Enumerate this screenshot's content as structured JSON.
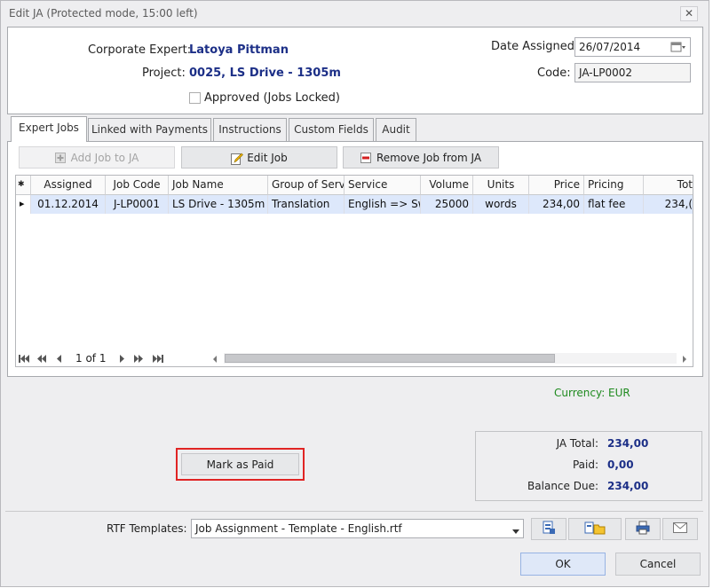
{
  "window": {
    "title": "Edit JA (Protected mode, 15:00 left)",
    "close_label": "✕"
  },
  "header": {
    "expert_label": "Corporate Expert:",
    "expert_value": "Latoya Pittman",
    "project_label": "Project:",
    "project_value": "0025, LS Drive - 1305m",
    "approved_label": "Approved (Jobs Locked)",
    "approved_checked": false,
    "date_label": "Date Assigned:",
    "date_value": "26/07/2014",
    "code_label": "Code:",
    "code_value": "JA-LP0002"
  },
  "tabs": [
    "Expert Jobs",
    "Linked with Payments",
    "Instructions",
    "Custom Fields",
    "Audit"
  ],
  "active_tab": "Expert Jobs",
  "toolbar": {
    "add_label": "Add Job to JA",
    "edit_label": "Edit Job",
    "remove_label": "Remove Job from JA"
  },
  "grid": {
    "corner": "✱",
    "columns": [
      "Assigned",
      "Job Code",
      "Job Name",
      "Group of Serv",
      "Service",
      "Volume",
      "Units",
      "Price",
      "Pricing",
      "Tot"
    ],
    "rows": [
      {
        "indicator": "▸",
        "cells": [
          "01.12.2014",
          "J-LP0001",
          "LS Drive - 1305m -",
          "Translation",
          "English => Sw",
          "25000",
          "words",
          "234,00",
          "flat fee",
          "234,("
        ]
      }
    ],
    "pager": {
      "page_text": "1 of 1"
    }
  },
  "currency": {
    "label": "Currency:",
    "value": "EUR",
    "color": "#1f8a1f"
  },
  "mark_paid_label": "Mark as Paid",
  "totals": {
    "ja_total_label": "JA Total:",
    "ja_total_value": "234,00",
    "paid_label": "Paid:",
    "paid_value": "0,00",
    "balance_label": "Balance Due:",
    "balance_value": "234,00"
  },
  "rtf": {
    "label": "RTF Templates:",
    "selected": "Job Assignment - Template - English.rtf"
  },
  "footer": {
    "ok_label": "OK",
    "cancel_label": "Cancel"
  },
  "icons": [
    "add-icon",
    "edit-pencil-icon",
    "remove-icon",
    "calendar-icon",
    "open-template-icon",
    "open-folder-icon",
    "print-icon",
    "email-icon"
  ],
  "colors": {
    "accent_text": "#1c2f87",
    "highlight": "#e02424",
    "selected_row": "#dde8fb"
  }
}
